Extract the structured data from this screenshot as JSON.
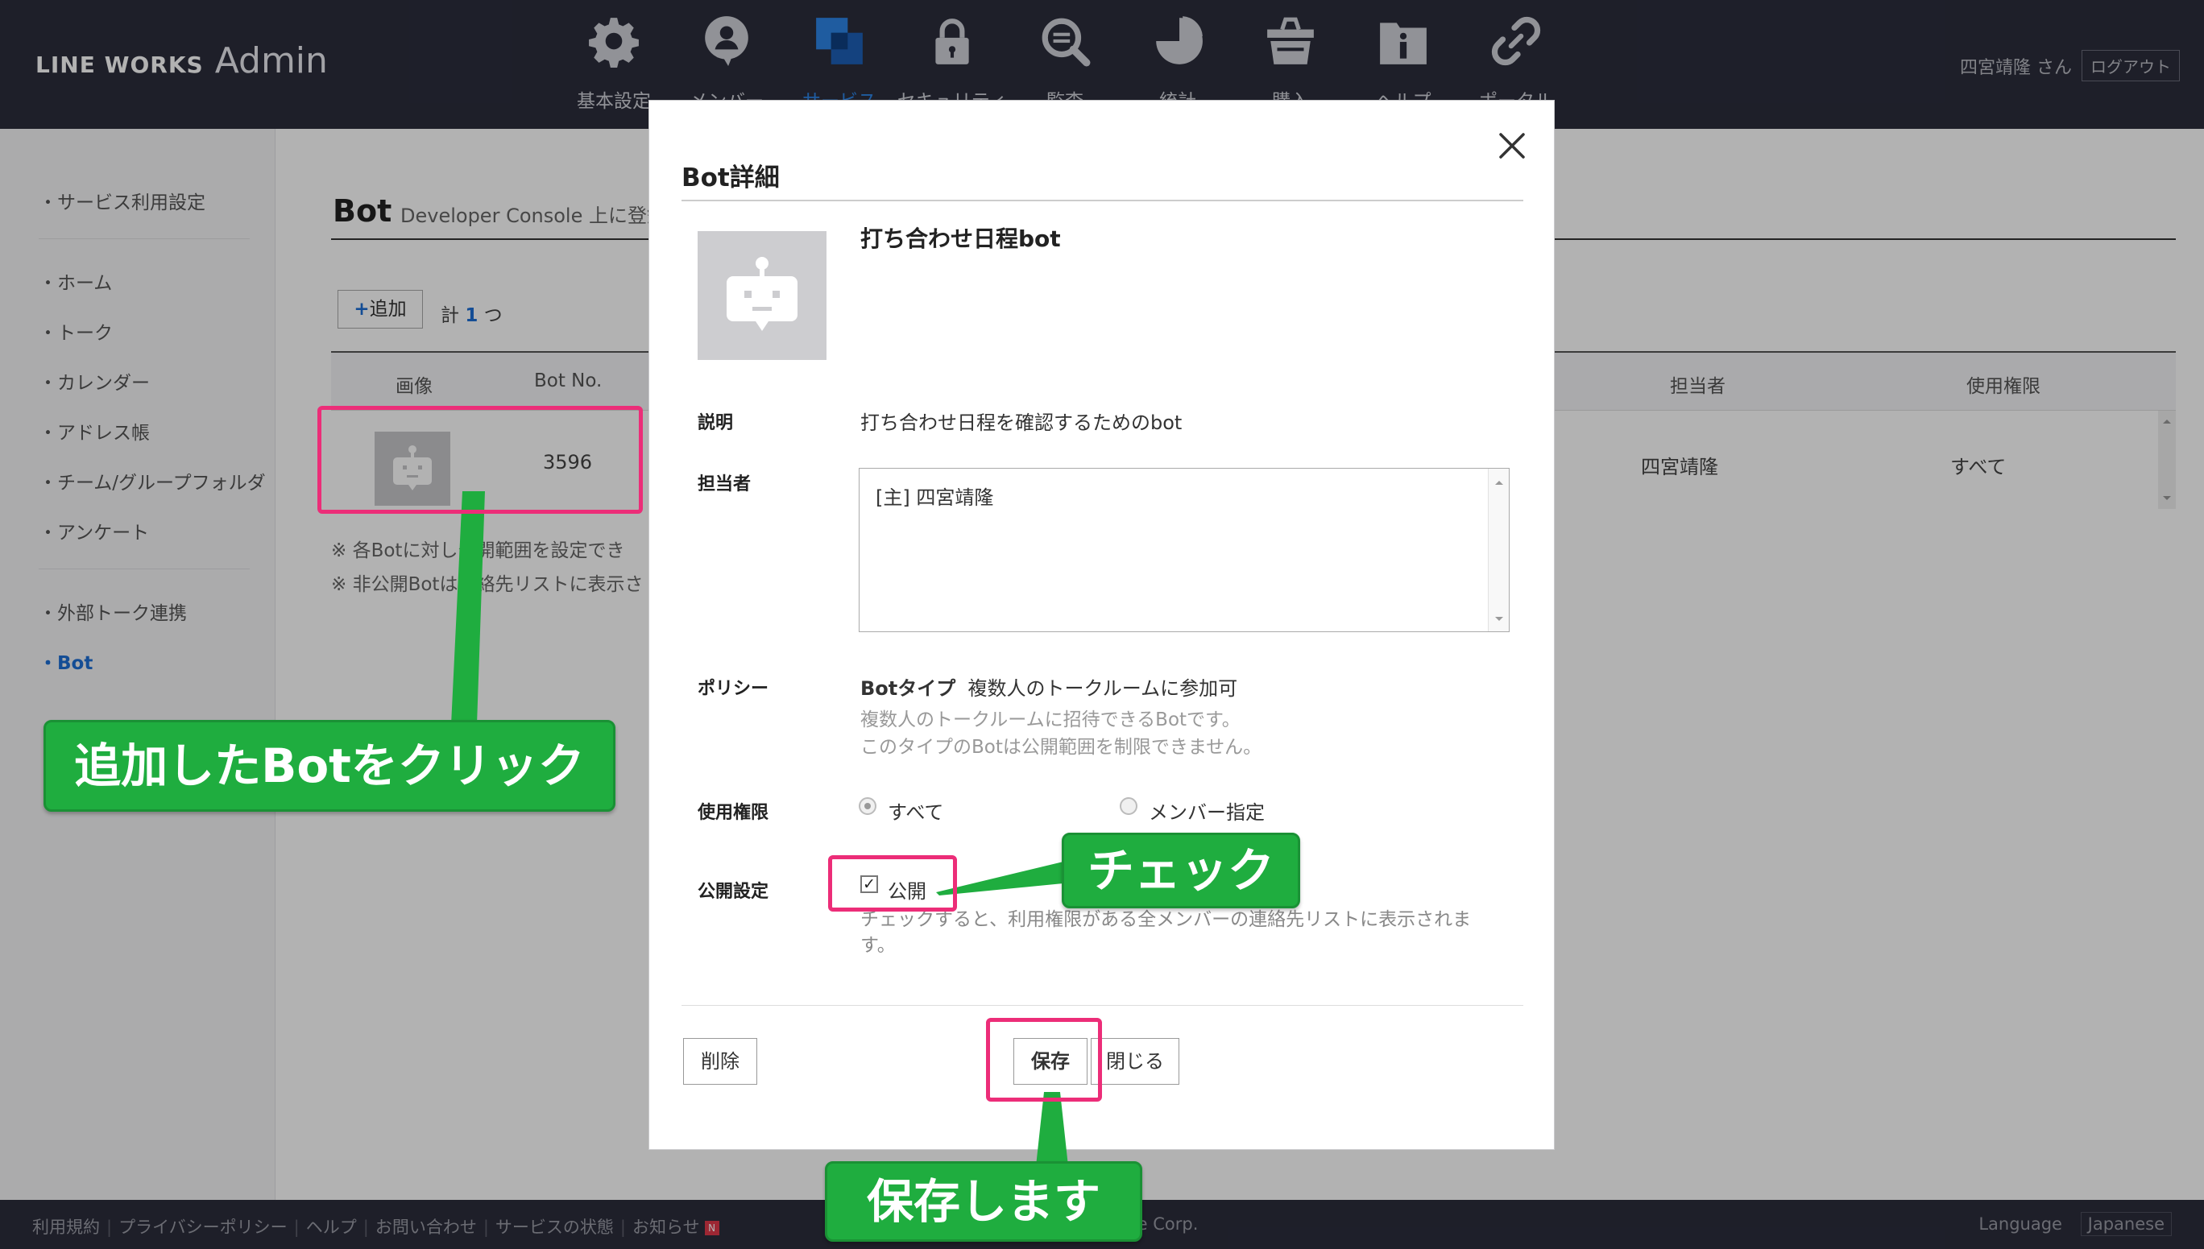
{
  "header": {
    "logo_main": "LINE WORKS",
    "logo_sub": "Admin",
    "nav": [
      {
        "label": "基本設定",
        "icon": "gear-icon"
      },
      {
        "label": "メンバー",
        "icon": "member-icon"
      },
      {
        "label": "サービス",
        "icon": "service-icon"
      },
      {
        "label": "セキュリティ",
        "icon": "lock-icon"
      },
      {
        "label": "監査",
        "icon": "audit-icon"
      },
      {
        "label": "統計",
        "icon": "chart-icon"
      },
      {
        "label": "購入",
        "icon": "basket-icon"
      },
      {
        "label": "ヘルプ",
        "icon": "help-icon"
      },
      {
        "label": "ポータル",
        "icon": "link-icon"
      }
    ],
    "active_nav": "サービス",
    "user_name": "四宮靖隆 さん",
    "logout": "ログアウト"
  },
  "sidebar": {
    "items": [
      {
        "label": "・サービス利用設定"
      },
      {
        "label": "・ホーム"
      },
      {
        "label": "・トーク"
      },
      {
        "label": "・カレンダー"
      },
      {
        "label": "・アドレス帳"
      },
      {
        "label": "・チーム/グループフォルダ"
      },
      {
        "label": "・アンケート"
      },
      {
        "label": "・外部トーク連携"
      },
      {
        "label": "・Bot"
      }
    ],
    "active": "・Bot"
  },
  "main": {
    "title": "Bot",
    "subtitle": "Developer Console 上に登録",
    "add_label": "追加",
    "count_prefix": "計",
    "count_value": "1",
    "count_suffix": "つ",
    "columns": [
      "画像",
      "Bot No.",
      "担当者",
      "使用権限"
    ],
    "row": {
      "bot_no": "3596",
      "manager": "四宮靖隆",
      "permission": "すべて"
    },
    "notes": [
      "※ 各Botに対し公開範囲を設定でき",
      "※ 非公開Botは連絡先リストに表示さ"
    ]
  },
  "modal": {
    "title": "Bot詳細",
    "bot_name": "打ち合わせ日程bot",
    "desc_label": "説明",
    "desc_value": "打ち合わせ日程を確認するためのbot",
    "manager_label": "担当者",
    "manager_value": "[主] 四宮靖隆",
    "policy_label": "ポリシー",
    "policy_type_label": "Botタイプ",
    "policy_type_value": "複数人のトークルームに参加可",
    "policy_desc_1": "複数人のトークルームに招待できるBotです。",
    "policy_desc_2": "このタイプのBotは公開範囲を制限できません。",
    "permission_label": "使用権限",
    "permission_options": [
      {
        "label": "すべて",
        "selected": true
      },
      {
        "label": "メンバー指定",
        "selected": false
      }
    ],
    "public_label": "公開設定",
    "public_checkbox_label": "公開",
    "public_checked": true,
    "public_desc_1": "チェックすると、利用権限がある全メンバーの連絡先リストに表示されま",
    "public_desc_2": "す。",
    "delete_label": "削除",
    "save_label": "保存",
    "close_label": "閉じる"
  },
  "annotations": {
    "click_bot": "追加したBotをクリック",
    "check": "チェック",
    "save": "保存します"
  },
  "footer": {
    "links": [
      "利用規約",
      "プライバシーポリシー",
      "ヘルプ",
      "お問い合わせ",
      "サービスの状態",
      "お知らせ"
    ],
    "badge": "N",
    "copyright": "ile Corp.",
    "language_label": "Language",
    "language_value": "Japanese"
  },
  "colors": {
    "header_bg": "#2b2d3c",
    "accent_blue": "#1d6fd6",
    "highlight_pink": "#ec2d78",
    "callout_green": "#1fad3f"
  }
}
